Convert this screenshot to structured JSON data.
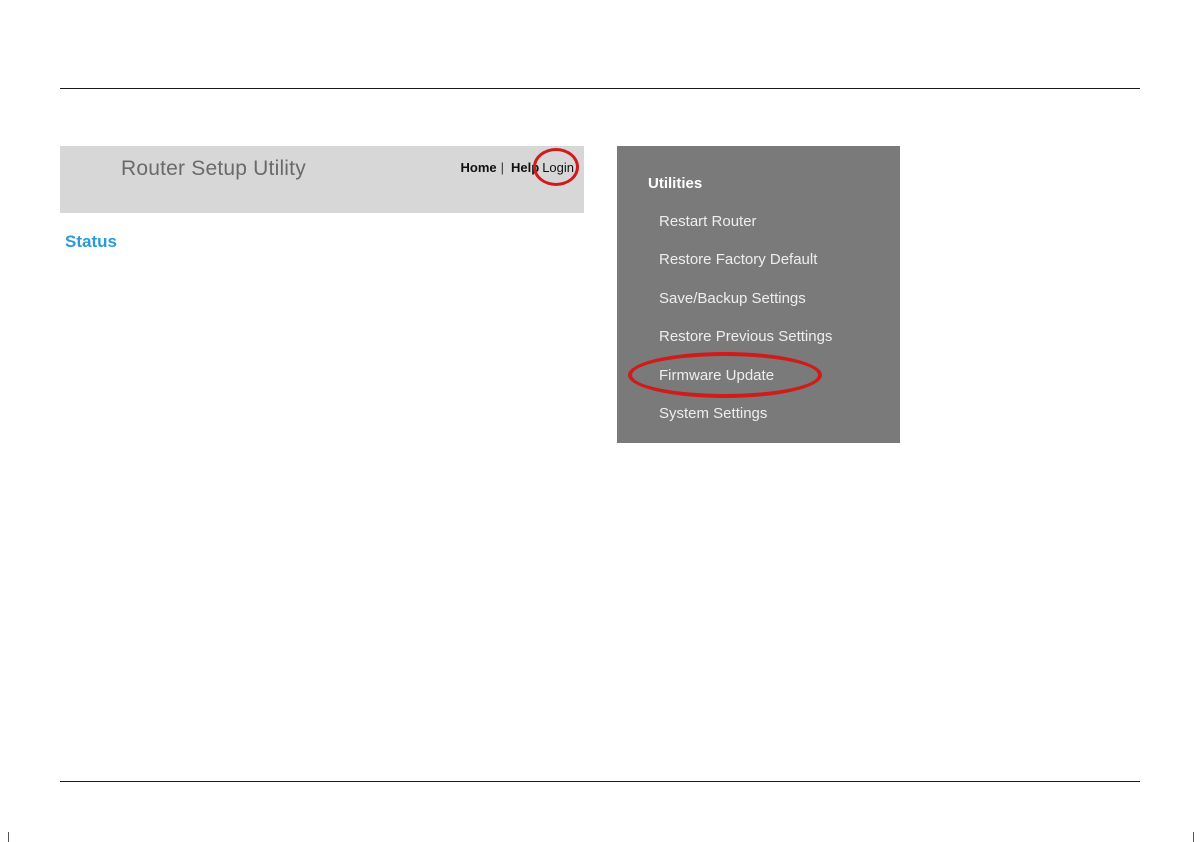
{
  "router_page": {
    "title": "Router Setup Utility",
    "nav": {
      "home": "Home",
      "separator_1": "|",
      "help": "Help",
      "login": "Login"
    },
    "section_title": "Status"
  },
  "utilities_menu": {
    "heading": "Utilities",
    "items": [
      "Restart Router",
      "Restore Factory Default",
      "Save/Backup Settings",
      "Restore Previous Settings",
      "Firmware Update",
      "System Settings"
    ]
  },
  "highlight_color": "#d11a1a",
  "accent_color": "#2a9ad8"
}
